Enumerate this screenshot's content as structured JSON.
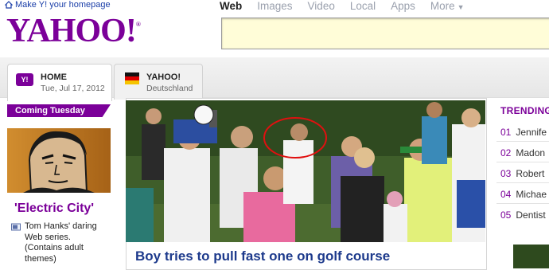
{
  "topbar": {
    "homepage_label": "Make Y! your homepage"
  },
  "logo": {
    "text": "YAHOO!",
    "tm": "®"
  },
  "search": {
    "tabs": [
      {
        "label": "Web",
        "active": true
      },
      {
        "label": "Images",
        "active": false
      },
      {
        "label": "Video",
        "active": false
      },
      {
        "label": "Local",
        "active": false
      },
      {
        "label": "Apps",
        "active": false
      },
      {
        "label": "More",
        "active": false
      }
    ],
    "input_value": ""
  },
  "location_tabs": [
    {
      "title": "HOME",
      "subtitle": "Tue, Jul 17, 2012",
      "icon": "yahoo-icon"
    },
    {
      "title": "YAHOO!",
      "subtitle": "Deutschland",
      "icon": "german-flag-icon"
    }
  ],
  "promo": {
    "banner": "Coming Tuesday",
    "title": "'Electric City'",
    "description": "Tom Hanks' daring Web series. (Contains adult themes)"
  },
  "story": {
    "caption": "Boy tries to pull fast one on golf course"
  },
  "trending": {
    "title": "TRENDING",
    "items": [
      {
        "num": "01",
        "text": "Jennife"
      },
      {
        "num": "02",
        "text": "Madon"
      },
      {
        "num": "03",
        "text": "Robert"
      },
      {
        "num": "04",
        "text": "Michae"
      },
      {
        "num": "05",
        "text": "Dentist"
      }
    ]
  },
  "colors": {
    "brand": "#7b0099",
    "link": "#1d3a8c",
    "search_bg": "#fffdd8"
  }
}
